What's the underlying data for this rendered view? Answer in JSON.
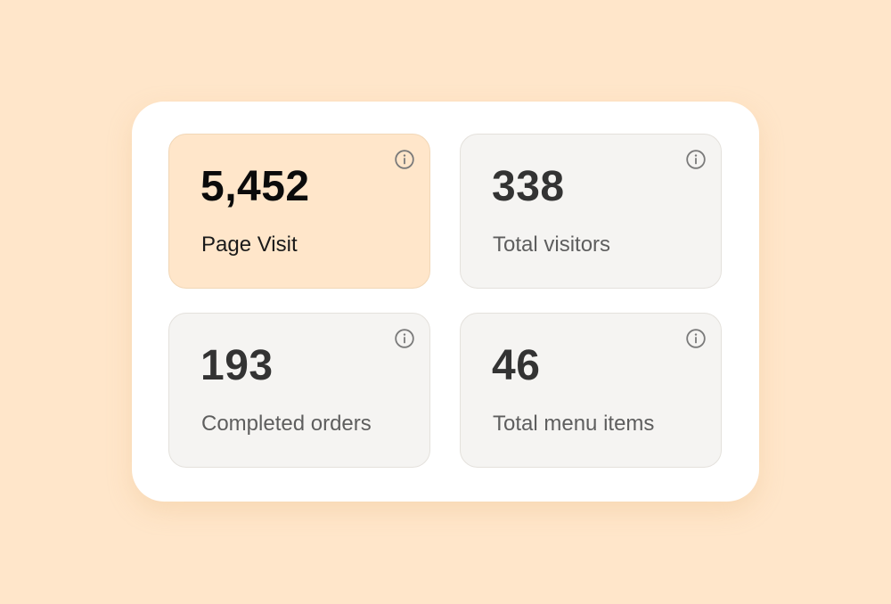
{
  "stats": [
    {
      "value": "5,452",
      "label": "Page Visit",
      "icon": "info-icon"
    },
    {
      "value": "338",
      "label": "Total visitors",
      "icon": "info-icon"
    },
    {
      "value": "193",
      "label": "Completed orders",
      "icon": "info-icon"
    },
    {
      "value": "46",
      "label": "Total menu items",
      "icon": "info-icon"
    }
  ],
  "colors": {
    "page_background": "#FFE6CA",
    "panel_background": "#FFFFFF",
    "card_background": "#F5F4F2",
    "active_card_background": "#FFE6CA",
    "value_text": "#333333",
    "label_text": "#5E5E5E",
    "icon": "#7A7A7A"
  }
}
